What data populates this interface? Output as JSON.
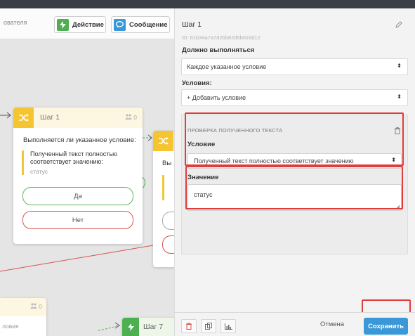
{
  "toolbar": {
    "search_fragment": "ователя",
    "action_label": "Действие",
    "message_label": "Сообщение"
  },
  "canvas": {
    "step1": {
      "title": "Шаг 1",
      "count": "0",
      "question": "Выполняется ли указанное условие:",
      "condition_line1": "Полученный текст полностью",
      "condition_line2": "соответствует значению:",
      "condition_value": "статус",
      "yes_label": "Да",
      "no_label": "Нет"
    },
    "step2": {
      "text_fragment": "Вы"
    },
    "step_bottom_left": {
      "count": "0",
      "text_fragment": "ловия"
    },
    "step7": {
      "title": "Шаг 7"
    }
  },
  "panel": {
    "title": "Шаг 1",
    "id": "ID: 61b34a7a7d2bb82d5b016d12",
    "must_execute_label": "Должно выполняться",
    "must_execute_value": "Каждое указанное условие",
    "conditions_label": "Условия:",
    "add_condition": "+ Добавить условие",
    "condition_block": {
      "title": "ПРОВЕРКА ПОЛУЧЕННОГО ТЕКСТА",
      "condition_label": "Условие",
      "condition_value": "Полученный текст полностью соответствует значению",
      "value_label": "Значение",
      "value_text": "статус"
    },
    "footer": {
      "cancel_label": "Отмена",
      "save_label": "Сохранить"
    }
  },
  "colors": {
    "accent_blue": "#3a98d8",
    "action_green": "#4cb050",
    "step_yellow": "#f4c531",
    "highlight_red": "#e03c3c"
  }
}
